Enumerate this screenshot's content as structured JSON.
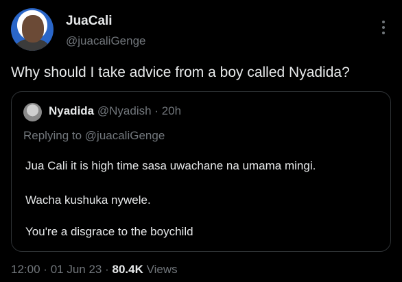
{
  "author": {
    "name": "JuaCali",
    "handle": "@juacaliGenge"
  },
  "tweet": {
    "text": "Why should I take advice from a boy called Nyadida?"
  },
  "quoted": {
    "name": "Nyadida",
    "handle": "@Nyadish",
    "separator": "·",
    "time": "20h",
    "replying_prefix": "Replying to ",
    "replying_to": "@juacaliGenge",
    "lines": [
      "Jua Cali it is high time sasa uwachane na umama mingi.",
      "Wacha kushuka nywele.",
      "You're a disgrace to the boychild"
    ]
  },
  "footer": {
    "time": "12:00",
    "sep": "·",
    "date": "01 Jun 23",
    "sep2": "·",
    "views_count": "80.4K",
    "views_label": "Views"
  },
  "icons": {
    "more": "more-vertical-icon"
  }
}
